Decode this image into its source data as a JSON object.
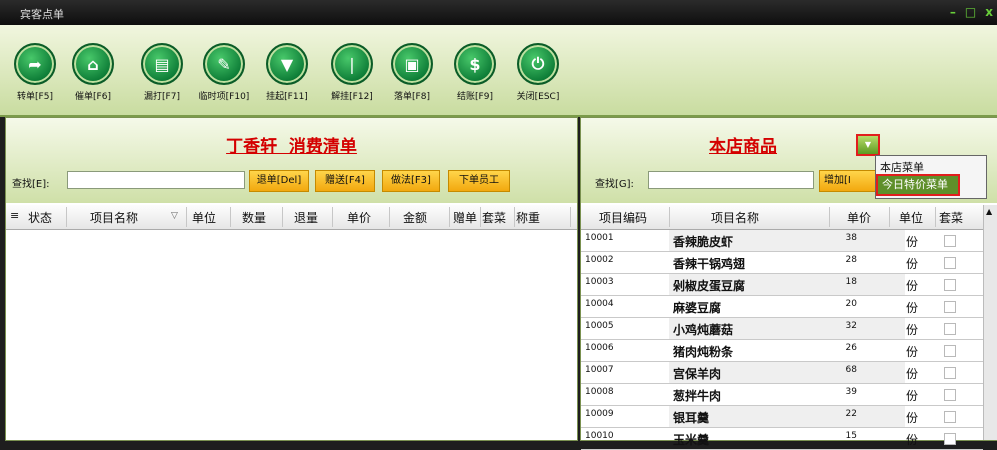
{
  "window": {
    "title": "宾客点单",
    "controls": [
      "–",
      "□",
      "x"
    ]
  },
  "toolbar": [
    {
      "label": "转单[F5]",
      "icon": "share-arrow-icon"
    },
    {
      "label": "催单[F6]",
      "icon": "bank-icon"
    },
    {
      "label": "漏打[F7]",
      "icon": "document-icon"
    },
    {
      "label": "临时项[F10]",
      "icon": "utensils-icon"
    },
    {
      "label": "挂起[F11]",
      "icon": "hang-icon"
    },
    {
      "label": "解挂[F12]",
      "icon": "unhang-icon"
    },
    {
      "label": "落单[F8]",
      "icon": "screen-icon"
    },
    {
      "label": "结账[F9]",
      "icon": "dollar-icon"
    },
    {
      "label": "关闭[ESC]",
      "icon": "power-icon"
    }
  ],
  "left": {
    "title": "丁香轩  消费清单",
    "search_label": "查找[E]:",
    "search_value": "",
    "buttons": [
      "退单[Del]",
      "赠送[F4]",
      "做法[F3]",
      "下单员工"
    ],
    "columns": [
      "状态",
      "项目名称",
      "单位",
      "数量",
      "退量",
      "单价",
      "金额",
      "赠单",
      "套菜",
      "称重"
    ]
  },
  "right": {
    "title": "本店商品",
    "search_label": "查找[G]:",
    "search_value": "",
    "add_button": "增加[I",
    "dropdown": {
      "items": [
        "本店菜单",
        "今日特价菜单"
      ]
    },
    "columns": [
      "项目编码",
      "项目名称",
      "单价",
      "单位",
      "套菜"
    ],
    "rows": [
      {
        "code": "10001",
        "name": "香辣脆皮虾",
        "price": "38",
        "unit": "份"
      },
      {
        "code": "10002",
        "name": "香辣干锅鸡翅",
        "price": "28",
        "unit": "份"
      },
      {
        "code": "10003",
        "name": "剁椒皮蛋豆腐",
        "price": "18",
        "unit": "份"
      },
      {
        "code": "10004",
        "name": "麻婆豆腐",
        "price": "20",
        "unit": "份"
      },
      {
        "code": "10005",
        "name": "小鸡炖蘑菇",
        "price": "32",
        "unit": "份"
      },
      {
        "code": "10006",
        "name": "猪肉炖粉条",
        "price": "26",
        "unit": "份"
      },
      {
        "code": "10007",
        "name": "宫保羊肉",
        "price": "68",
        "unit": "份"
      },
      {
        "code": "10008",
        "name": "葱拌牛肉",
        "price": "39",
        "unit": "份"
      },
      {
        "code": "10009",
        "name": "银耳羹",
        "price": "22",
        "unit": "份"
      },
      {
        "code": "10010",
        "name": "玉米羹",
        "price": "15",
        "unit": "份"
      }
    ]
  },
  "colors": {
    "accent_green": "#0b7a35",
    "title_red": "#d40000",
    "button_orange": "#f2a80e"
  }
}
